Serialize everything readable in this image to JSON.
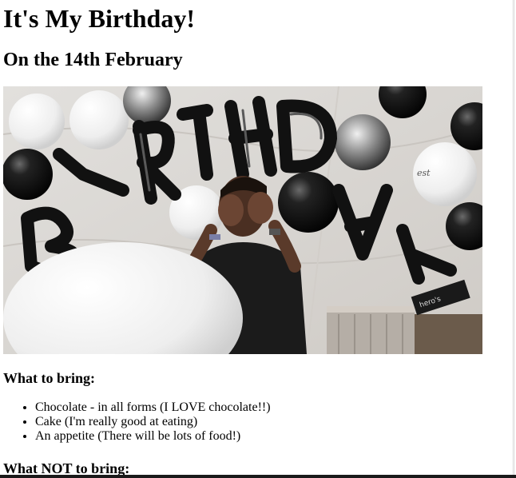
{
  "page": {
    "title": "It's My Birthday!",
    "subtitle": "On the 14th February"
  },
  "photo": {
    "description_icon": "birthday-balloons-photo-icon",
    "colors": {
      "backdrop": "#e8e6e3",
      "balloon_black": "#141414",
      "balloon_white": "#f4f4f4",
      "balloon_silver": "#9a9a9a"
    }
  },
  "bring": {
    "heading": "What to bring:",
    "items": [
      "Chocolate - in all forms (I LOVE chocolate!!)",
      "Cake (I'm really good at eating)",
      "An appetite (There will be lots of food!)"
    ]
  },
  "not_bring": {
    "heading": "What NOT to bring:"
  }
}
